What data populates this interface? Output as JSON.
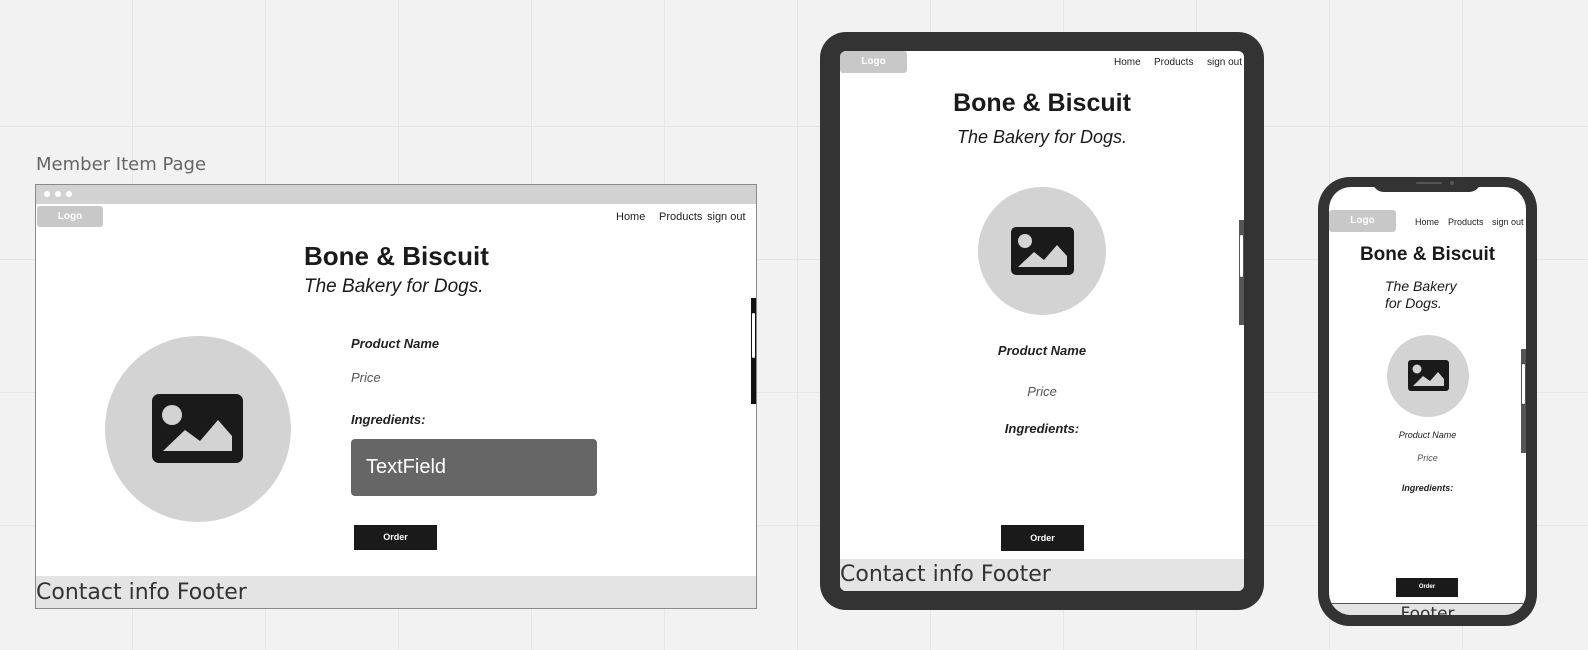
{
  "frame_label": "Member Item Page",
  "site": {
    "logo": "Logo",
    "nav": [
      "Home",
      "Products",
      "sign out"
    ],
    "title": "Bone & Biscuit",
    "tagline": "The Bakery for Dogs.",
    "tagline_line1": "The Bakery",
    "tagline_line2": "for Dogs."
  },
  "product": {
    "name": "Product Name",
    "price": "Price",
    "ingredients_label": "Ingredients:",
    "textfield": "TextField",
    "order_label": "Order"
  },
  "footer": {
    "desktop": "Contact info Footer",
    "tablet": "Contact info Footer",
    "phone": "Footer"
  },
  "colors": {
    "canvas": "#f2f2f2",
    "device_body": "#333333",
    "button": "#1a1a1a",
    "textfield": "#666666",
    "image_placeholder": "#d3d3d3",
    "footer": "#e4e4e4"
  }
}
